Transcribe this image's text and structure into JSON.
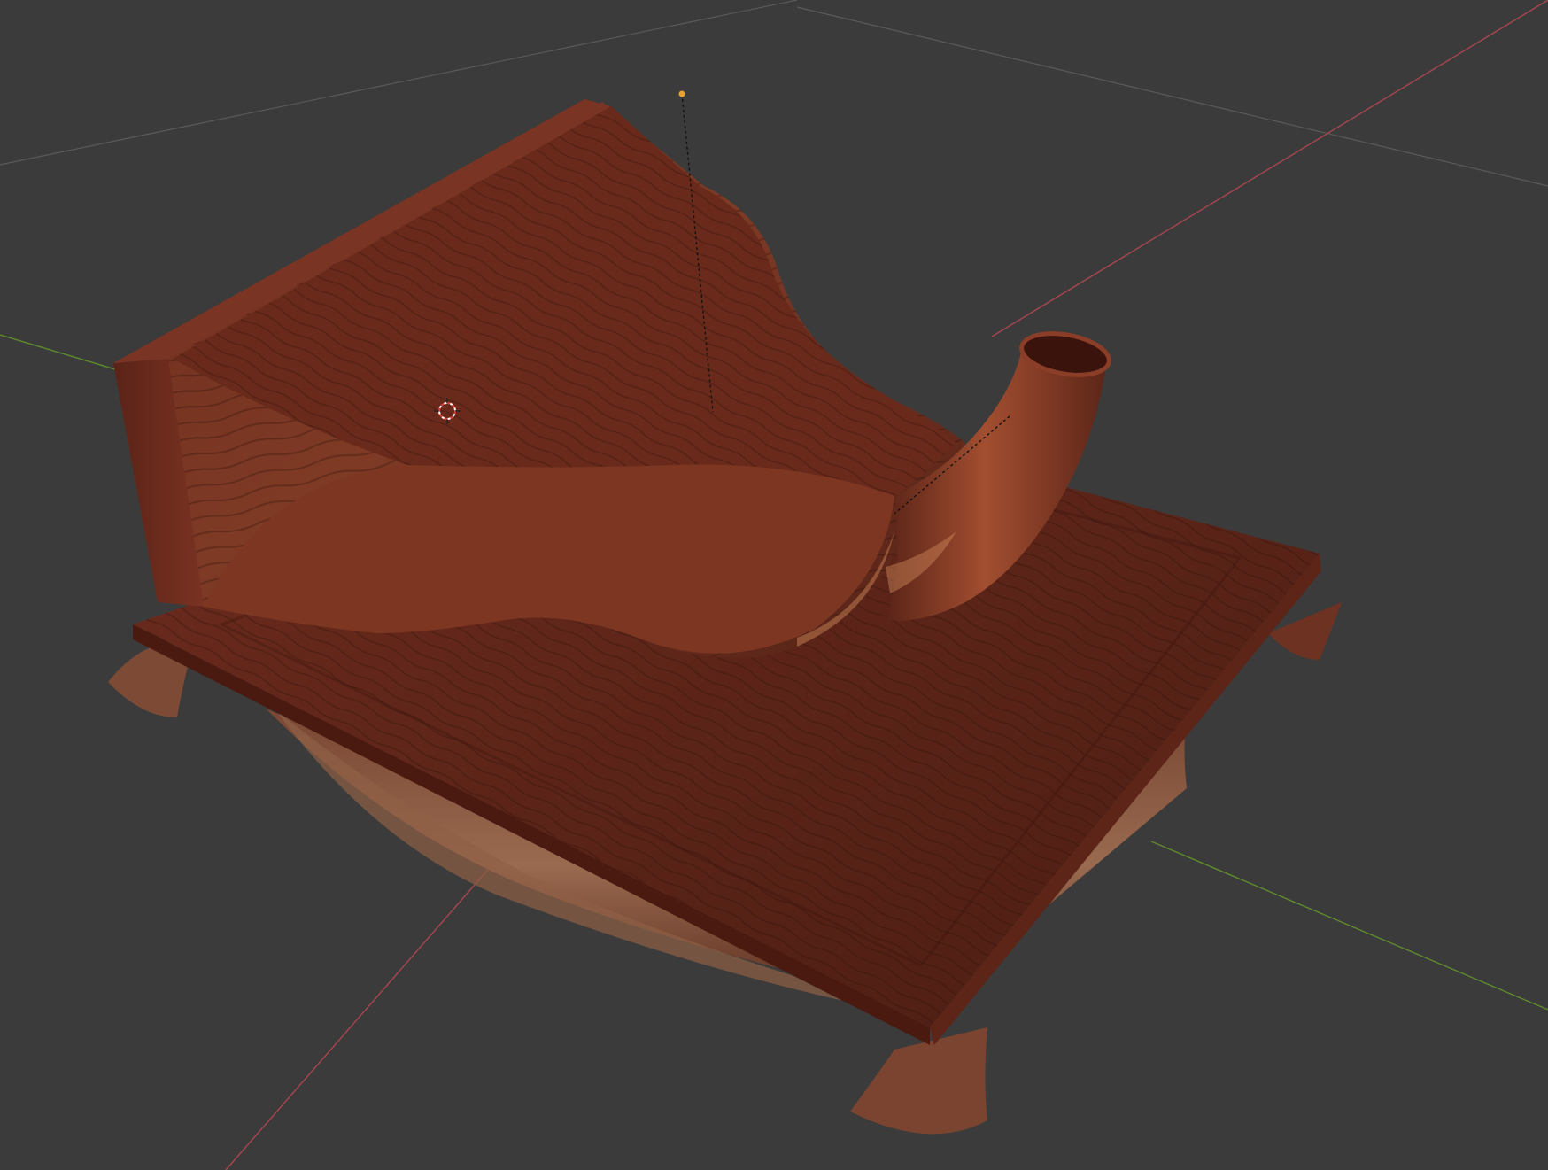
{
  "viewport": {
    "background": "#3b3b3b",
    "x_axis_color": "#a8464f",
    "y_axis_color": "#5f8a2e",
    "grid_line_color": "#555555",
    "wood_dark": "#4a1f14",
    "wood_mid": "#7a3422",
    "wood_light": "#9c4a2e",
    "origin_marker_color": "#e8a030",
    "cursor_color": "#e04040"
  },
  "scene": {
    "objects": [
      "gramophone-horn",
      "gramophone-base"
    ],
    "icons": [
      "3d-cursor-icon",
      "light-origin-icon"
    ]
  }
}
